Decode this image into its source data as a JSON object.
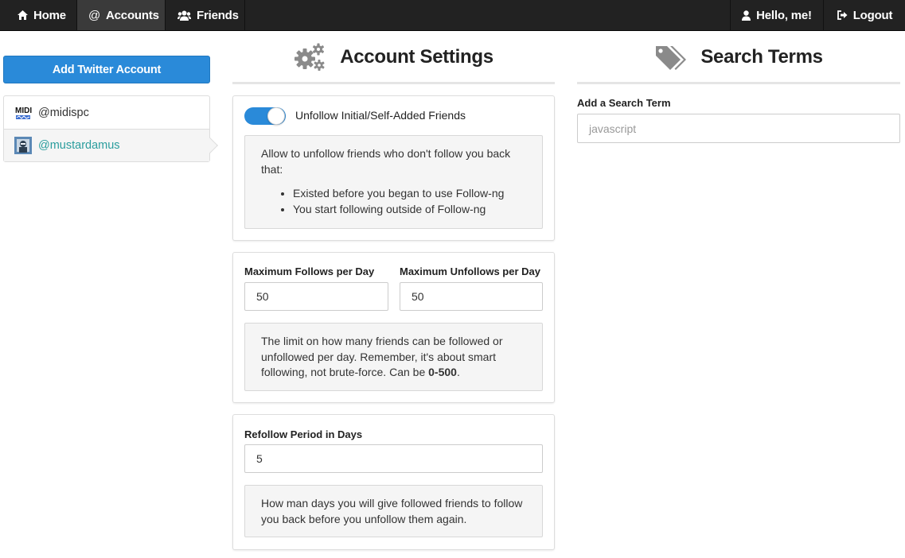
{
  "nav": {
    "home": "Home",
    "accounts": "Accounts",
    "friends": "Friends",
    "hello": "Hello, me!",
    "logout": "Logout"
  },
  "sidebar": {
    "add_button": "Add Twitter Account",
    "accounts": [
      {
        "handle": "@midispc",
        "selected": false
      },
      {
        "handle": "@mustardamus",
        "selected": true
      }
    ]
  },
  "settings": {
    "title": "Account Settings",
    "unfollow_toggle": {
      "label": "Unfollow Initial/Self-Added Friends",
      "on": true
    },
    "unfollow_help": {
      "intro": "Allow to unfollow friends who don't follow you back that:",
      "items": [
        "Existed before you began to use Follow-ng",
        "You start following outside of Follow-ng"
      ]
    },
    "max_follows_label": "Maximum Follows per Day",
    "max_follows_value": "50",
    "max_unfollows_label": "Maximum Unfollows per Day",
    "max_unfollows_value": "50",
    "limit_help_pre": "The limit on how many friends can be followed or unfollowed per day. Remember, it's about smart following, not brute-force. Can be ",
    "limit_help_bold": "0-500",
    "limit_help_post": ".",
    "refollow_label": "Refollow Period in Days",
    "refollow_value": "5",
    "refollow_help": "How man days you will give followed friends to follow you back before you unfollow them again."
  },
  "search": {
    "title": "Search Terms",
    "label": "Add a Search Term",
    "placeholder": "javascript"
  },
  "colors": {
    "navbar": "#222222",
    "primary": "#2a8ad9",
    "selected_link": "#2a9d9d"
  }
}
